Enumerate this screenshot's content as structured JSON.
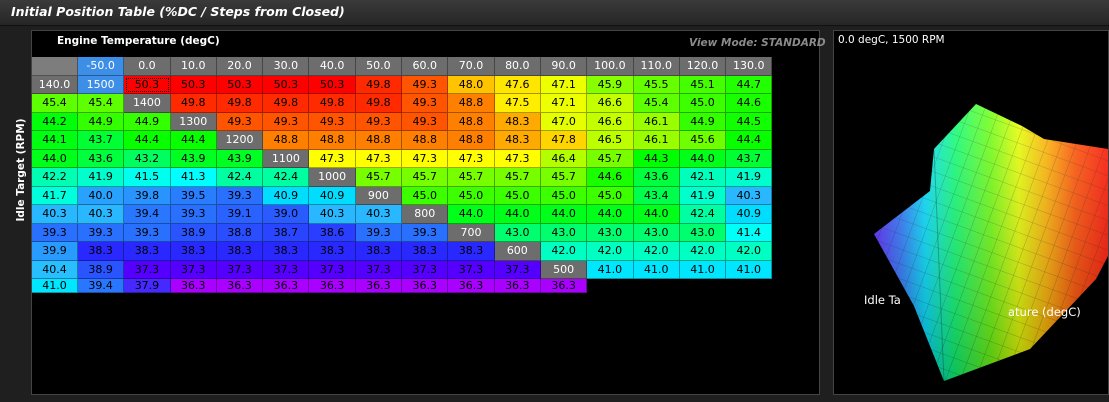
{
  "title": "Initial Position Table (%DC / Steps from Closed)",
  "x_axis_label": "Engine Temperature (degC)",
  "y_axis_label": "Idle Target (RPM)",
  "view_mode": "View Mode: STANDARD",
  "view_caption": "0.0 degC, 1500 RPM",
  "view_axis_labels": {
    "left": "Idle Ta",
    "right": "ature (degC)"
  },
  "columns": [
    "-50.0",
    "0.0",
    "10.0",
    "20.0",
    "30.0",
    "40.0",
    "50.0",
    "60.0",
    "70.0",
    "80.0",
    "90.0",
    "100.0",
    "110.0",
    "120.0",
    "130.0",
    "140.0"
  ],
  "rows": [
    {
      "rpm": "1500",
      "values": [
        "50.3",
        "50.3",
        "50.3",
        "50.3",
        "50.3",
        "49.8",
        "49.3",
        "48.0",
        "47.6",
        "47.1",
        "45.9",
        "45.5",
        "45.1",
        "44.7",
        "45.4",
        "45.4"
      ]
    },
    {
      "rpm": "1400",
      "values": [
        "49.8",
        "49.8",
        "49.8",
        "49.8",
        "49.8",
        "49.3",
        "48.8",
        "47.5",
        "47.1",
        "46.6",
        "45.4",
        "45.0",
        "44.6",
        "44.2",
        "44.9",
        "44.9"
      ]
    },
    {
      "rpm": "1300",
      "values": [
        "49.3",
        "49.3",
        "49.3",
        "49.3",
        "49.3",
        "48.8",
        "48.3",
        "47.0",
        "46.6",
        "46.1",
        "44.9",
        "44.5",
        "44.1",
        "43.7",
        "44.4",
        "44.4"
      ]
    },
    {
      "rpm": "1200",
      "values": [
        "48.8",
        "48.8",
        "48.8",
        "48.8",
        "48.8",
        "48.3",
        "47.8",
        "46.5",
        "46.1",
        "45.6",
        "44.4",
        "44.0",
        "43.6",
        "43.2",
        "43.9",
        "43.9"
      ]
    },
    {
      "rpm": "1100",
      "values": [
        "47.3",
        "47.3",
        "47.3",
        "47.3",
        "47.3",
        "46.4",
        "45.7",
        "44.3",
        "44.0",
        "43.7",
        "42.2",
        "41.9",
        "41.5",
        "41.3",
        "42.4",
        "42.4"
      ]
    },
    {
      "rpm": "1000",
      "values": [
        "45.7",
        "45.7",
        "45.7",
        "45.7",
        "45.7",
        "44.6",
        "43.6",
        "42.1",
        "41.9",
        "41.7",
        "40.0",
        "39.8",
        "39.5",
        "39.3",
        "40.9",
        "40.9"
      ]
    },
    {
      "rpm": "900",
      "values": [
        "45.0",
        "45.0",
        "45.0",
        "45.0",
        "45.0",
        "43.4",
        "41.9",
        "40.3",
        "40.3",
        "40.3",
        "39.4",
        "39.3",
        "39.1",
        "39.0",
        "40.3",
        "40.3"
      ]
    },
    {
      "rpm": "800",
      "values": [
        "44.0",
        "44.0",
        "44.0",
        "44.0",
        "44.0",
        "42.4",
        "40.9",
        "39.3",
        "39.3",
        "39.3",
        "38.9",
        "38.8",
        "38.7",
        "38.6",
        "39.3",
        "39.3"
      ]
    },
    {
      "rpm": "700",
      "values": [
        "43.0",
        "43.0",
        "43.0",
        "43.0",
        "43.0",
        "41.4",
        "39.9",
        "38.3",
        "38.3",
        "38.3",
        "38.3",
        "38.3",
        "38.3",
        "38.3",
        "38.3",
        "38.3"
      ]
    },
    {
      "rpm": "600",
      "values": [
        "42.0",
        "42.0",
        "42.0",
        "42.0",
        "42.0",
        "40.4",
        "38.9",
        "37.3",
        "37.3",
        "37.3",
        "37.3",
        "37.3",
        "37.3",
        "37.3",
        "37.3",
        "37.3"
      ]
    },
    {
      "rpm": "500",
      "values": [
        "41.0",
        "41.0",
        "41.0",
        "41.0",
        "41.0",
        "39.4",
        "37.9",
        "36.3",
        "36.3",
        "36.3",
        "36.3",
        "36.3",
        "36.3",
        "36.3",
        "36.3",
        "36.3"
      ]
    }
  ],
  "selected": {
    "row": 0,
    "col": 0
  },
  "colors": {
    "header": "#6d6d6d",
    "selected_header": "#3d8ee6"
  }
}
